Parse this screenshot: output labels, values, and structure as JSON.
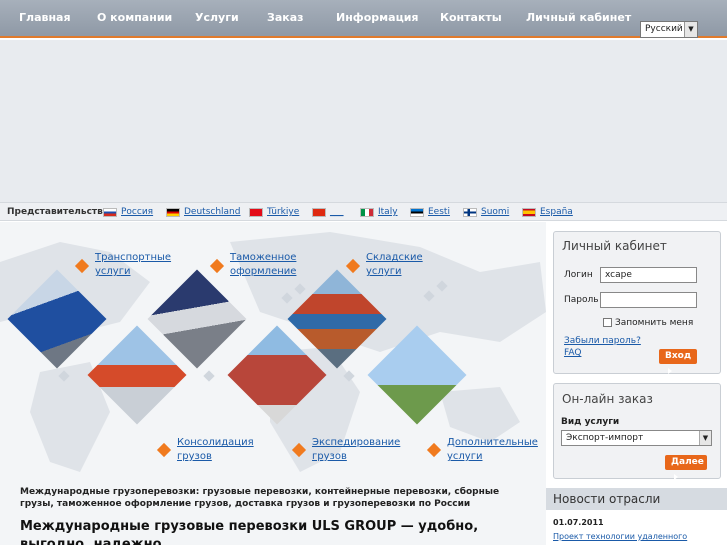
{
  "nav": {
    "items": [
      "Главная",
      "О компании",
      "Услуги",
      "Заказ",
      "Информация",
      "Контакты",
      "Личный кабинет"
    ],
    "language": "Русский"
  },
  "representatives": {
    "label": "Представительства:",
    "items": [
      {
        "label": "Россия",
        "flag": "russia-flag"
      },
      {
        "label": "Deutschland",
        "flag": "germany-flag"
      },
      {
        "label": "Türkiye",
        "flag": "turkey-flag"
      },
      {
        "label": "___",
        "flag": "china-flag"
      },
      {
        "label": "Italy",
        "flag": "italy-flag"
      },
      {
        "label": "Eesti",
        "flag": "estonia-flag"
      },
      {
        "label": "Suomi",
        "flag": "finland-flag"
      },
      {
        "label": "España",
        "flag": "spain-flag"
      }
    ]
  },
  "services": {
    "top": [
      {
        "line1": "Транспортные",
        "line2": "услуги"
      },
      {
        "line1": "Таможенное",
        "line2": "оформление"
      },
      {
        "line1": "Складские",
        "line2": "услуги"
      }
    ],
    "bottom": [
      {
        "line1": "Консолидация",
        "line2": "грузов"
      },
      {
        "line1": "Экспедирование",
        "line2": "грузов"
      },
      {
        "line1": "Дополнительные",
        "line2": "услуги"
      }
    ]
  },
  "content": {
    "subtitle": "Международные грузоперевозки: грузовые перевозки, контейнерные перевозки, сборные грузы, таможенное оформление грузов, доставка грузов и грузоперевозки по России",
    "headline": "Международные грузовые перевозки ULS GROUP — удобно, выгодно, надежно"
  },
  "login": {
    "title": "Личный кабинет",
    "login_label": "Логин",
    "login_value": "xcape",
    "password_label": "Пароль",
    "remember_label": "Запомнить меня",
    "forgot_link": "Забыли пароль?",
    "faq_link": "FAQ",
    "submit": "Вход"
  },
  "order": {
    "title": "Он-лайн заказ",
    "service_label": "Вид услуги",
    "service_value": "Экспорт-импорт",
    "next": "Далее"
  },
  "news": {
    "title": "Новости отрасли",
    "date": "01.07.2011",
    "link": "Проект технологии удаленного"
  },
  "colors": {
    "accent": "#e8671a",
    "nav": "#98a2ae",
    "link": "#1a5aa8"
  }
}
